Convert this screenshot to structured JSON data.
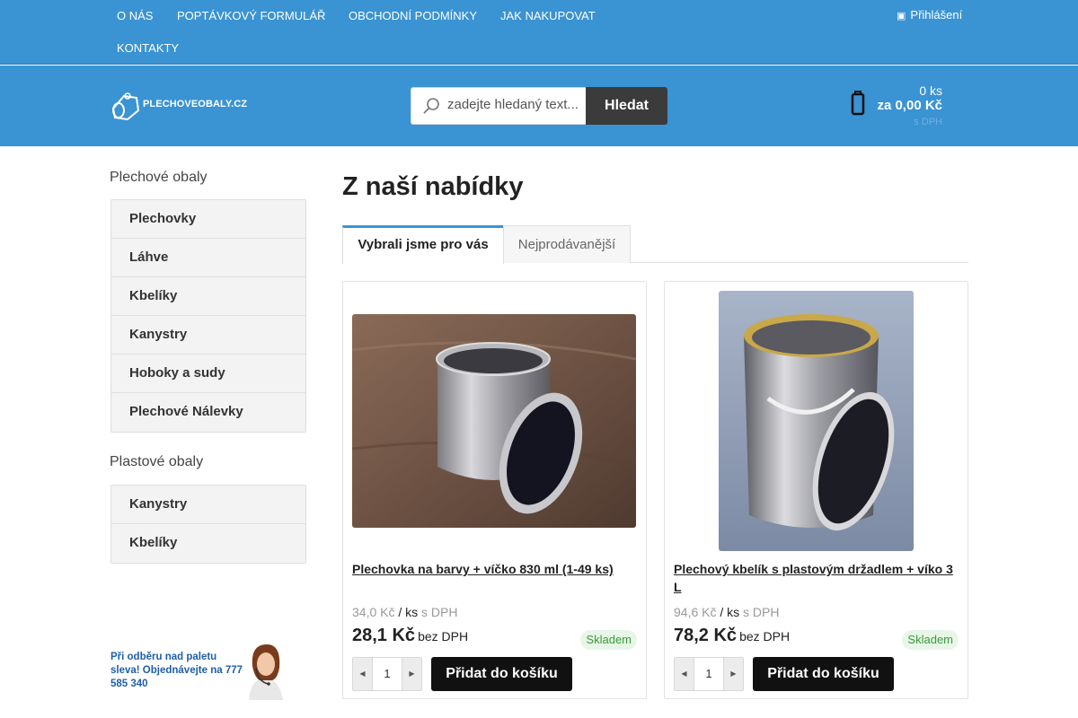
{
  "topnav": {
    "items": [
      {
        "label": "O NÁS"
      },
      {
        "label": "POPTÁVKOVÝ FORMULÁŘ"
      },
      {
        "label": "OBCHODNÍ PODMÍNKY"
      },
      {
        "label": "JAK NAKUPOVAT"
      },
      {
        "label": "KONTAKTY"
      }
    ],
    "login_label": "Přihlášení",
    "login_icon": "user-icon"
  },
  "header": {
    "logo_text": "PLECHOVEOBALY.CZ",
    "search": {
      "placeholder": "zadejte hledaný text...",
      "button_label": "Hledat"
    },
    "cart": {
      "count": "0 ks",
      "total": "za 0,00 Kč",
      "vat_note": "s DPH"
    }
  },
  "sidebar": {
    "groups": [
      {
        "title": "Plechové obaly",
        "items": [
          "Plechovky",
          "Láhve",
          "Kbelíky",
          "Kanystry",
          "Hoboky a sudy",
          "Plechové Nálevky"
        ]
      },
      {
        "title": "Plastové obaly",
        "items": [
          "Kanystry",
          "Kbelíky"
        ]
      }
    ],
    "promo_text": "Při odběru nad paletu sleva! Objednávejte na 777 585 340"
  },
  "main": {
    "title": "Z naší nabídky",
    "tabs": [
      {
        "label": "Vybrali jsme pro vás",
        "active": true
      },
      {
        "label": "Nejprodávanější",
        "active": false
      }
    ],
    "products": [
      {
        "name": "Plechovka na barvy + víčko 830 ml (1-49 ks)",
        "price_with_vat": "34,0 Kč",
        "unit": "/ ks",
        "vat_label": "s DPH",
        "price": "28,1 Kč",
        "price_note": "bez DPH",
        "stock": "Skladem",
        "qty": "1",
        "add_label": "Přidat do košíku"
      },
      {
        "name": "Plechový kbelík s plastovým držadlem + víko 3 L",
        "price_with_vat": "94,6 Kč",
        "unit": "/ ks",
        "vat_label": "s DPH",
        "price": "78,2 Kč",
        "price_note": "bez DPH",
        "stock": "Skladem",
        "qty": "1",
        "add_label": "Přidat do košíku"
      }
    ]
  },
  "colors": {
    "brand_blue": "#3a93d3",
    "button_dark": "#111111",
    "stock_green": "#3a9a3a"
  }
}
